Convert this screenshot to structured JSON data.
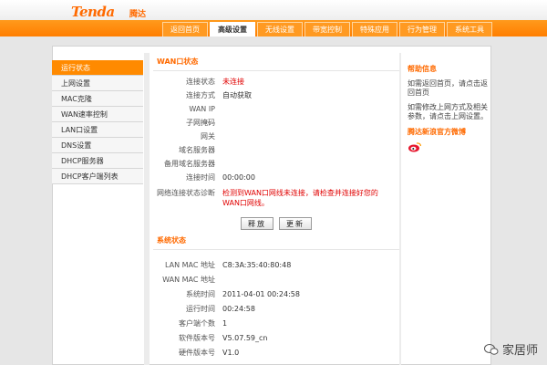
{
  "header": {
    "logo": "Tenda",
    "logo_cn": "腾达",
    "tabs": [
      {
        "label": "返回首页"
      },
      {
        "label": "高级设置"
      },
      {
        "label": "无线设置"
      },
      {
        "label": "带宽控制"
      },
      {
        "label": "特殊应用"
      },
      {
        "label": "行为管理"
      },
      {
        "label": "系统工具"
      }
    ],
    "active_tab": "高级设置"
  },
  "sidebar": {
    "items": [
      {
        "label": "运行状态"
      },
      {
        "label": "上网设置"
      },
      {
        "label": "MAC克隆"
      },
      {
        "label": "WAN速率控制"
      },
      {
        "label": "LAN口设置"
      },
      {
        "label": "DNS设置"
      },
      {
        "label": "DHCP服务器"
      },
      {
        "label": "DHCP客户端列表"
      }
    ],
    "active_item": "运行状态"
  },
  "wan": {
    "title": "WAN口状态",
    "rows": [
      {
        "label": "连接状态",
        "value": "未连接"
      },
      {
        "label": "连接方式",
        "value": "自动获取"
      },
      {
        "label": "WAN IP",
        "value": ""
      },
      {
        "label": "子网掩码",
        "value": ""
      },
      {
        "label": "网关",
        "value": ""
      },
      {
        "label": "域名服务器",
        "value": ""
      },
      {
        "label": "备用域名服务器",
        "value": ""
      },
      {
        "label": "连接时间",
        "value": "00:00:00"
      }
    ],
    "diagnosis_label": "网络连接状态诊断",
    "diagnosis_value": "检测到WAN口网线未连接，请检查并连接好您的WAN口网线。",
    "release_button": "释放",
    "renew_button": "更新"
  },
  "system": {
    "title": "系统状态",
    "rows": [
      {
        "label": "LAN MAC 地址",
        "value": "C8:3A:35:40:80:48"
      },
      {
        "label": "WAN MAC 地址",
        "value": ""
      },
      {
        "label": "系统时间",
        "value": "2011-04-01 00:24:58"
      },
      {
        "label": "运行时间",
        "value": "00:24:58"
      },
      {
        "label": "客户端个数",
        "value": "1"
      },
      {
        "label": "软件版本号",
        "value": "V5.07.59_cn"
      },
      {
        "label": "硬件版本号",
        "value": "V1.0"
      }
    ]
  },
  "help": {
    "title": "帮助信息",
    "para1": "如需返回首页，请点击返回首页",
    "para2": "如需修改上网方式及相关参数，请点击上网设置。",
    "weibo_link": "腾达新浪官方微博"
  },
  "watermark": {
    "text": "家居师"
  },
  "colors": {
    "accent": "#ff8a00",
    "alert": "#e00000"
  }
}
